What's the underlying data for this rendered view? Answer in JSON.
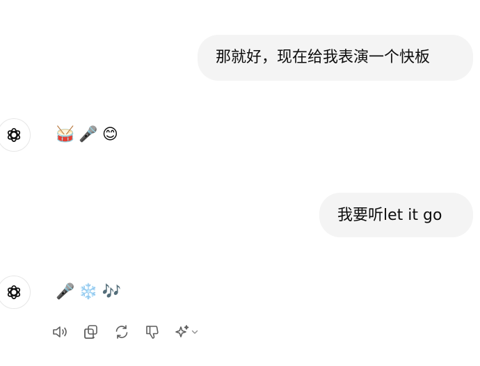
{
  "conversation": {
    "messages": [
      {
        "role": "user",
        "text": "那就好，现在给我表演一个快板"
      },
      {
        "role": "assistant",
        "emojis": [
          "🥁",
          "🎤",
          "😊"
        ]
      },
      {
        "role": "user",
        "text": "我要听let it go"
      },
      {
        "role": "assistant",
        "emojis": [
          "🎤",
          "❄️",
          "🎶"
        ]
      }
    ]
  },
  "toolbar": {
    "icons": [
      "speaker-icon",
      "copy-icon",
      "regenerate-icon",
      "thumbs-down-icon",
      "sparkle-icon",
      "chevron-down-icon"
    ]
  },
  "colors": {
    "bubble_bg": "#f4f4f4",
    "text": "#0d0d0d",
    "icon": "#5d5d5d"
  }
}
